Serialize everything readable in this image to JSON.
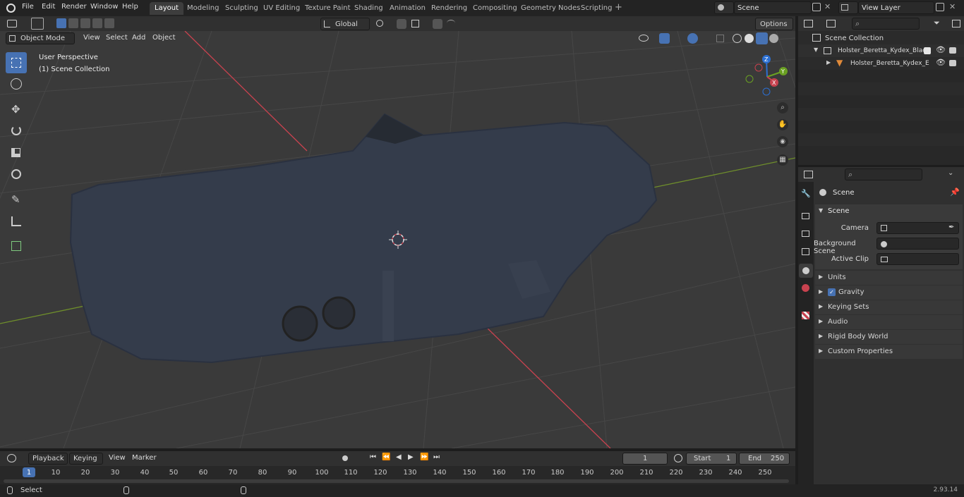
{
  "topbar": {
    "menus": [
      "File",
      "Edit",
      "Render",
      "Window",
      "Help"
    ],
    "workspaces": [
      "Layout",
      "Modeling",
      "Sculpting",
      "UV Editing",
      "Texture Paint",
      "Shading",
      "Animation",
      "Rendering",
      "Compositing",
      "Geometry Nodes",
      "Scripting"
    ],
    "active_workspace": "Layout",
    "scene_name": "Scene",
    "view_layer": "View Layer"
  },
  "viewport_header": {
    "mode": "Object Mode",
    "menus": [
      "View",
      "Select",
      "Add",
      "Object"
    ],
    "transform_orientation": "Global",
    "options_label": "Options"
  },
  "viewport": {
    "perspective_label": "User Perspective",
    "collection_label": "(1) Scene Collection",
    "gizmo_axes": [
      "Z",
      "Y",
      "X"
    ]
  },
  "outliner": {
    "root": "Scene Collection",
    "items": [
      "Holster_Beretta_Kydex_Black",
      "Holster_Beretta_Kydex_E"
    ]
  },
  "properties": {
    "context": "Scene",
    "panel_title": "Scene",
    "fields": [
      {
        "label": "Camera",
        "value": ""
      },
      {
        "label": "Background Scene",
        "value": ""
      },
      {
        "label": "Active Clip",
        "value": ""
      }
    ],
    "subpanels": [
      "Units",
      "Gravity",
      "Keying Sets",
      "Audio",
      "Rigid Body World",
      "Custom Properties"
    ],
    "gravity_checked": true
  },
  "timeline": {
    "menus": [
      "Playback",
      "Keying",
      "View",
      "Marker"
    ],
    "current_frame": "1",
    "start_label": "Start",
    "start": "1",
    "end_label": "End",
    "end": "250",
    "ticks": [
      "1",
      "10",
      "20",
      "30",
      "40",
      "50",
      "60",
      "70",
      "80",
      "90",
      "100",
      "110",
      "120",
      "130",
      "140",
      "150",
      "160",
      "170",
      "180",
      "190",
      "200",
      "210",
      "220",
      "230",
      "240",
      "250"
    ]
  },
  "statusbar": {
    "left": "Select",
    "version": "2.93.14"
  },
  "colors": {
    "accent": "#4772b3",
    "bg_dark": "#1d1d1d",
    "panel": "#303030",
    "grid": "#444444",
    "x_axis": "#c8424f",
    "y_axis": "#6f8f2b"
  }
}
